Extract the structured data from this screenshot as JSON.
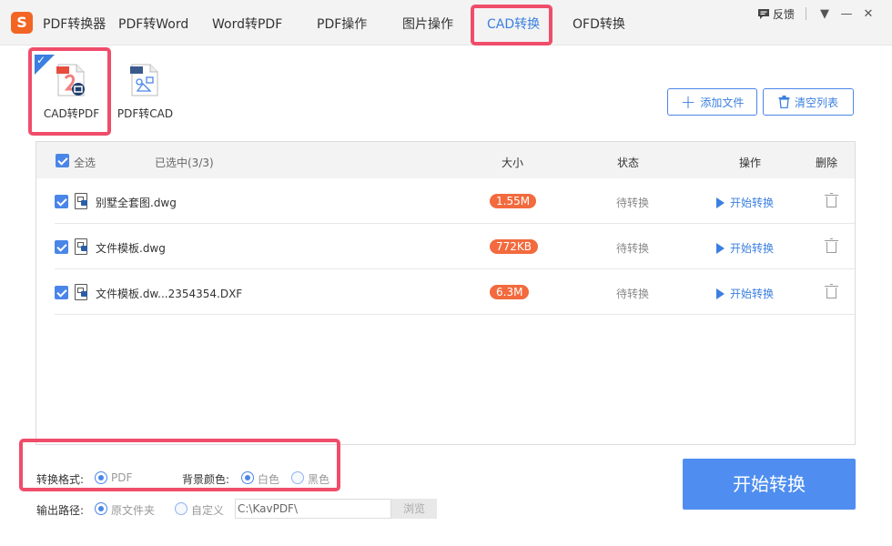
{
  "app": {
    "logo_letter": "S",
    "title": "PDF转换器"
  },
  "tabs": [
    {
      "label": "PDF转Word",
      "active": false
    },
    {
      "label": "Word转PDF",
      "active": false
    },
    {
      "label": "PDF操作",
      "active": false
    },
    {
      "label": "图片操作",
      "active": false
    },
    {
      "label": "CAD转换",
      "active": true
    },
    {
      "label": "OFD转换",
      "active": false
    }
  ],
  "window": {
    "feedback_label": "反馈",
    "menu_glyph": "▼",
    "minimize_glyph": "—",
    "close_glyph": "✕"
  },
  "modes": [
    {
      "label": "CAD转PDF",
      "selected": true,
      "icon": "cad-to-pdf-icon",
      "badge": "PDF"
    },
    {
      "label": "PDF转CAD",
      "selected": false,
      "icon": "pdf-to-cad-icon",
      "badge": "DWG"
    }
  ],
  "toolbar": {
    "add_label": "添加文件",
    "clear_label": "清空列表"
  },
  "table": {
    "headers": {
      "select_all": "全选",
      "selected_count": "已选中(3/3)",
      "size": "大小",
      "status": "状态",
      "action": "操作",
      "delete": "删除"
    },
    "rows": [
      {
        "name": "别墅全套图.dwg",
        "size": "1.55M",
        "status": "待转换",
        "action": "开始转换"
      },
      {
        "name": "文件模板.dwg",
        "size": "772KB",
        "status": "待转换",
        "action": "开始转换"
      },
      {
        "name": "文件模板.dw...2354354.DXF",
        "size": "6.3M",
        "status": "待转换",
        "action": "开始转换"
      }
    ]
  },
  "options": {
    "format_label": "转换格式:",
    "format_value": "PDF",
    "bg_label": "背景颜色:",
    "bg_white": "白色",
    "bg_black": "黑色",
    "bg_selected": "白色",
    "output_label": "输出路径:",
    "output_original": "原文件夹",
    "output_custom": "自定义",
    "output_selected": "原文件夹",
    "path_value": "C:\\KavPDF\\",
    "browse_label": "浏览"
  },
  "start_button_label": "开始转换",
  "colors": {
    "accent": "#4a86e8",
    "highlight": "#ef4d6a",
    "size_badge": "#f26a3d",
    "start_button": "#4f8ef0"
  }
}
